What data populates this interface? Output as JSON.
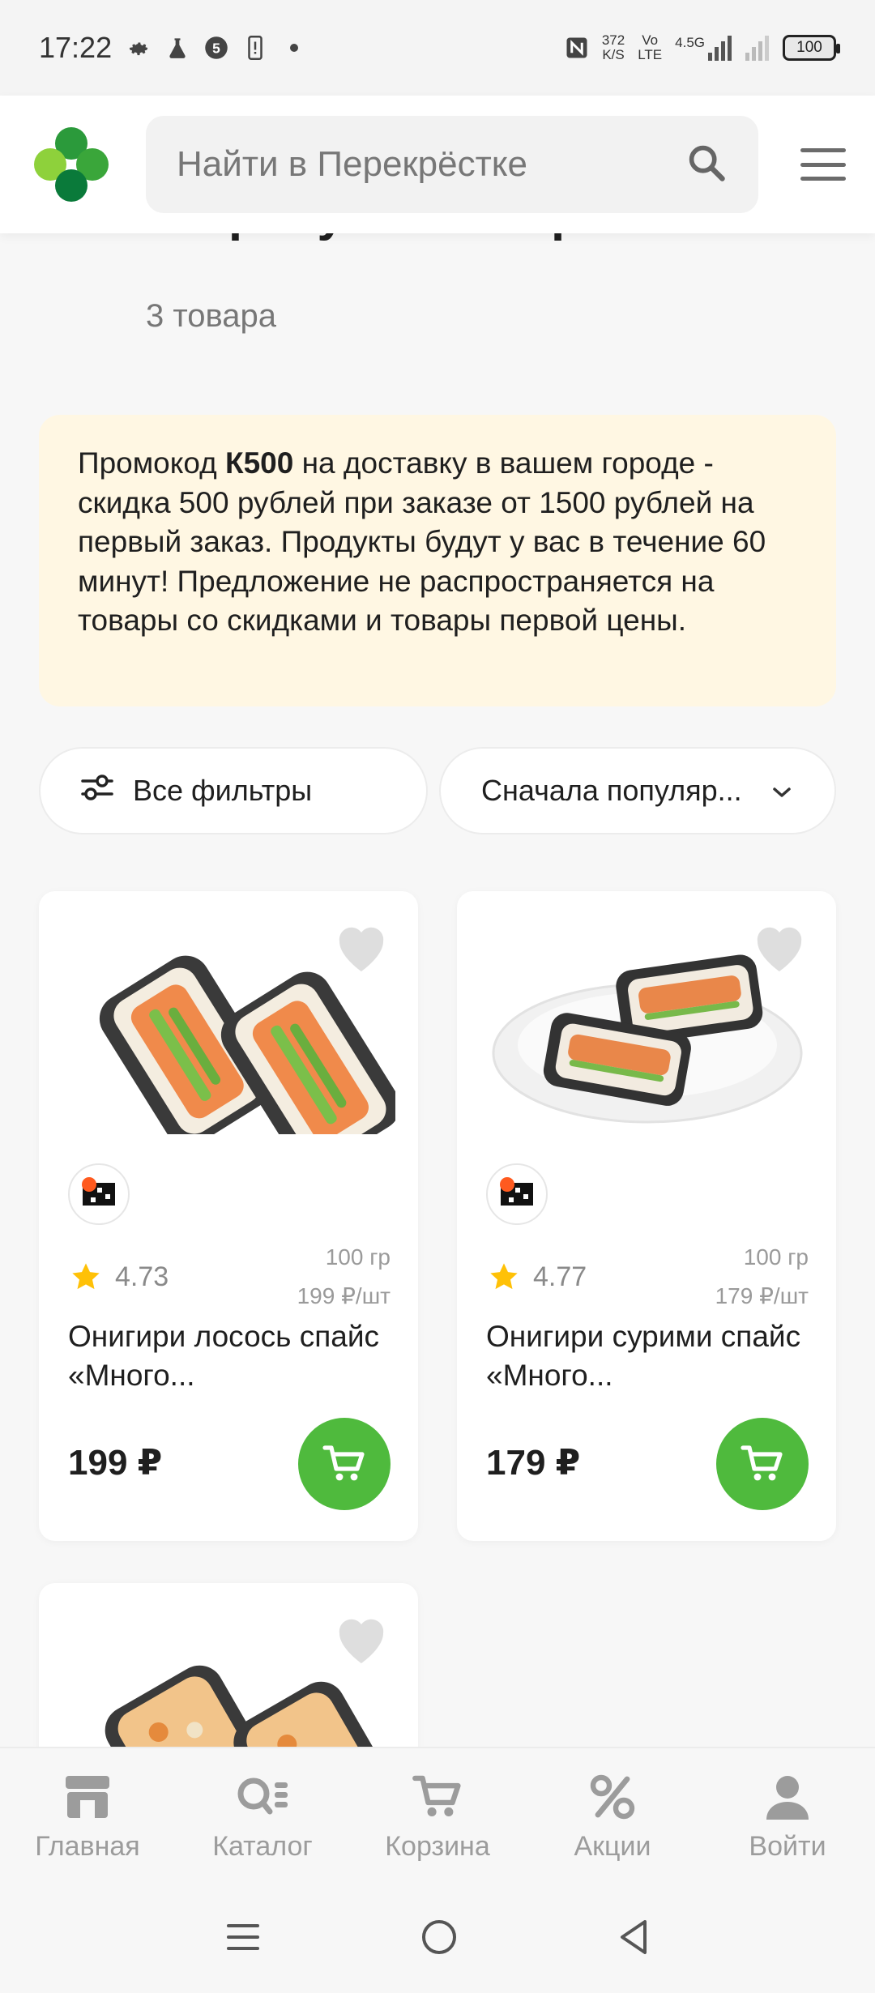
{
  "status_bar": {
    "time": "17:22",
    "net_speed_value": "372",
    "net_speed_unit": "K/S",
    "volte_top": "Vo",
    "volte_bottom": "LTE",
    "network_type": "4.5G",
    "battery": "100"
  },
  "header": {
    "search_placeholder": "Найти в Перекрёстке",
    "icons": [
      "logo",
      "search-icon",
      "menu-icon"
    ]
  },
  "results": {
    "title": "запросу: \"Онигири\"",
    "count": "3 товара"
  },
  "promo": {
    "prefix": "Промокод ",
    "code": "К500",
    "text": " на доставку в вашем городе - скидка 500 рублей при заказе от 1500 рублей на первый заказ. Продукты будут у вас в течение 60 минут! Предложение не распространяется на товары со скидками и товары первой цены."
  },
  "filters": {
    "all_filters_label": "Все фильтры",
    "sort_label": "Сначала популяр..."
  },
  "products": [
    {
      "rating": "4.73",
      "weight": "100 гр",
      "unit_price": "199 ₽/шт",
      "name": "Онигири лосось спайс «Много...",
      "price": "199 ₽"
    },
    {
      "rating": "4.77",
      "weight": "100 гр",
      "unit_price": "179 ₽/шт",
      "name": "Онигири сурими спайс «Много...",
      "price": "179 ₽"
    }
  ],
  "bottom_nav": {
    "home": "Главная",
    "catalog": "Каталог",
    "cart": "Корзина",
    "promos": "Акции",
    "login": "Войти"
  },
  "colors": {
    "accent_green": "#4fba3d",
    "logo_light_green": "#8ed13b",
    "logo_dark_green": "#0a7a3a",
    "promo_bg": "#fff7e3",
    "rating_star": "#ffc107"
  }
}
